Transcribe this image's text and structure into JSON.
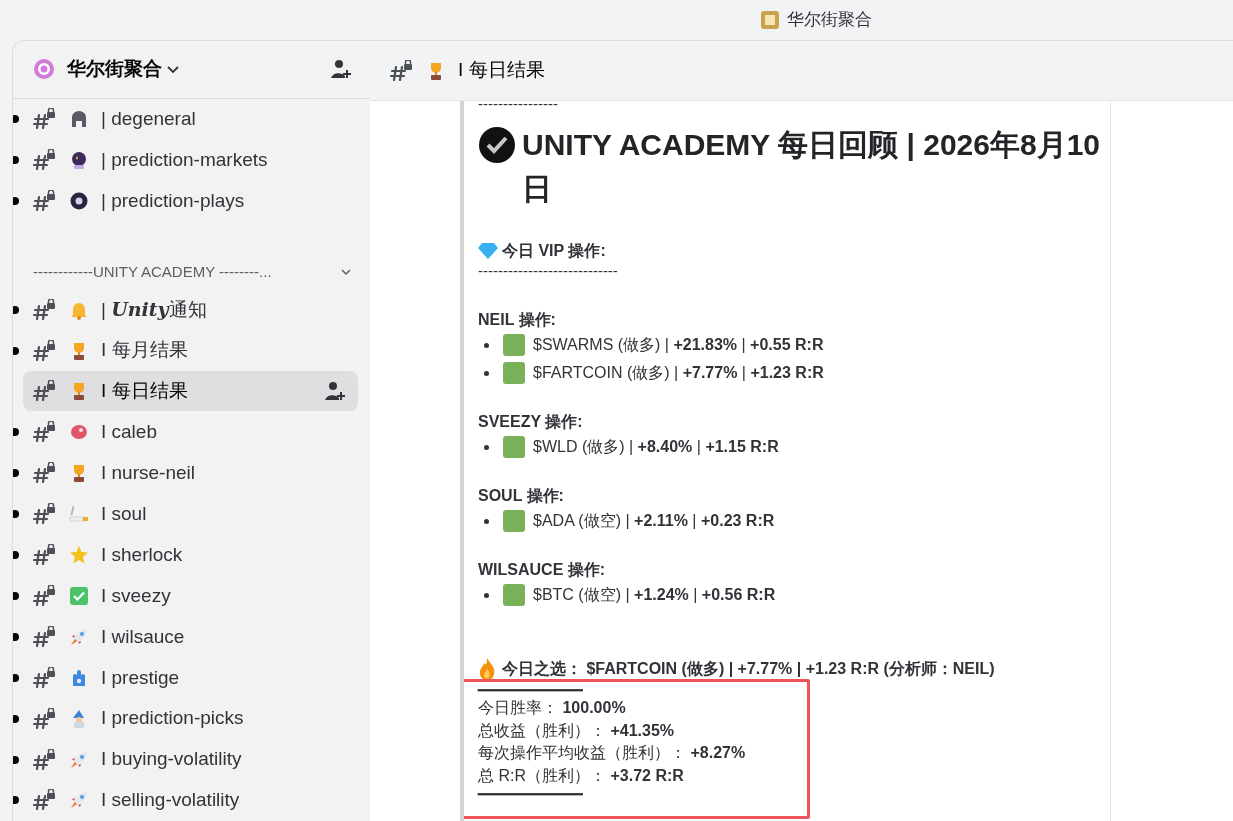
{
  "window": {
    "title": "华尔街聚合"
  },
  "server": {
    "name": "华尔街聚合"
  },
  "channels_before": [
    {
      "name": "| degeneral",
      "unread": true,
      "selected": false
    },
    {
      "name": "| prediction-markets",
      "unread": true,
      "selected": false
    },
    {
      "name": "| prediction-plays",
      "unread": true,
      "selected": false
    }
  ],
  "category": {
    "name": "------------UNITY ACADEMY --------...",
    "expanded": true
  },
  "channels": [
    {
      "name": "| **Unity**通知",
      "unread": true,
      "selected": false
    },
    {
      "name": "I 每月结果",
      "unread": true,
      "selected": false
    },
    {
      "name": "I 每日结果",
      "unread": false,
      "selected": true
    },
    {
      "name": "I caleb",
      "unread": true,
      "selected": false
    },
    {
      "name": "I nurse-neil",
      "unread": true,
      "selected": false
    },
    {
      "name": "I soul",
      "unread": true,
      "selected": false
    },
    {
      "name": "I sherlock",
      "unread": true,
      "selected": false
    },
    {
      "name": "I sveezy",
      "unread": true,
      "selected": false
    },
    {
      "name": "I wilsauce",
      "unread": true,
      "selected": false
    },
    {
      "name": "I prestige",
      "unread": true,
      "selected": false
    },
    {
      "name": "I prediction-picks",
      "unread": true,
      "selected": false
    },
    {
      "name": "I buying-volatility",
      "unread": true,
      "selected": false
    },
    {
      "name": "I selling-volatility",
      "unread": true,
      "selected": false
    }
  ],
  "channel_header": {
    "name": "I 每日结果"
  },
  "message": {
    "top_rule": "----------------",
    "title": "UNITY ACADEMY 每日回顾 | 2026年8月10日",
    "vip_heading": "今日 VIP 操作:",
    "vip_rule": "----------------------------",
    "groups": [
      {
        "heading": "NEIL 操作:",
        "trades": [
          {
            "text": "$SWARMS (做多) | **+21.83%** | **+0.55 R:R**"
          },
          {
            "text": "$FARTCOIN (做多) | **+7.77%** | **+1.23 R:R**"
          }
        ]
      },
      {
        "heading": "SVEEZY 操作:",
        "trades": [
          {
            "text": "$WLD (做多) | **+8.40%** | **+1.15 R:R**"
          }
        ]
      },
      {
        "heading": "SOUL 操作:",
        "trades": [
          {
            "text": "$ADA (做空) | **+2.11%** | **+0.23 R:R**"
          }
        ]
      },
      {
        "heading": "WILSAUCE 操作:",
        "trades": [
          {
            "text": "$BTC (做空) | **+1.24%** | **+0.56 R:R**"
          }
        ]
      }
    ],
    "pick": "今日之选：  $FARTCOIN (做多) | +7.77% | +1.23 R:R (分析师：NEIL)",
    "stats_rule": "━━━━━━━━━━━━━━━",
    "stats": [
      {
        "text": "今日胜率：  **100.00%**"
      },
      {
        "text": "总收益（胜利）：  **+41.35%**"
      },
      {
        "text": "每次操作平均收益（胜利）：  **+8.27%**"
      },
      {
        "text": "总 R:R（胜利）：  **+3.72 R:R**"
      }
    ],
    "bottom_rule": "━━━━━━━━━━━━━━━"
  }
}
